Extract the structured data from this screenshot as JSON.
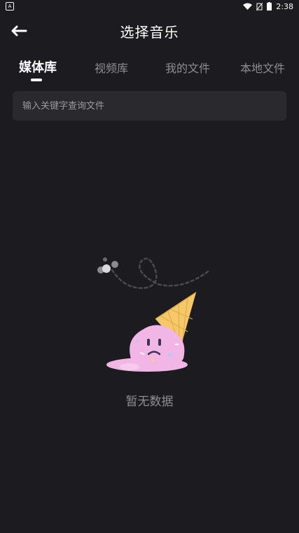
{
  "status_bar": {
    "time": "2:38",
    "icons": [
      "notification-a-icon",
      "wifi-icon",
      "no-sim-icon",
      "battery-icon"
    ]
  },
  "header": {
    "title": "选择音乐",
    "back_icon": "arrow-left-icon"
  },
  "tabs": [
    {
      "label": "媒体库",
      "active": true
    },
    {
      "label": "视频库",
      "active": false
    },
    {
      "label": "我的文件",
      "active": false
    },
    {
      "label": "本地文件",
      "active": false
    }
  ],
  "search": {
    "placeholder": "输入关键字查询文件",
    "value": ""
  },
  "empty_state": {
    "illustration": "melted-ice-cream-icon",
    "message": "暂无数据"
  },
  "colors": {
    "background": "#1c1b1f",
    "search_bg": "#2a292e",
    "active_tab": "#ffffff",
    "inactive_tab": "#8e8d93",
    "ice_cream_pink": "#f2b6e6",
    "cone": "#f5c86b"
  }
}
